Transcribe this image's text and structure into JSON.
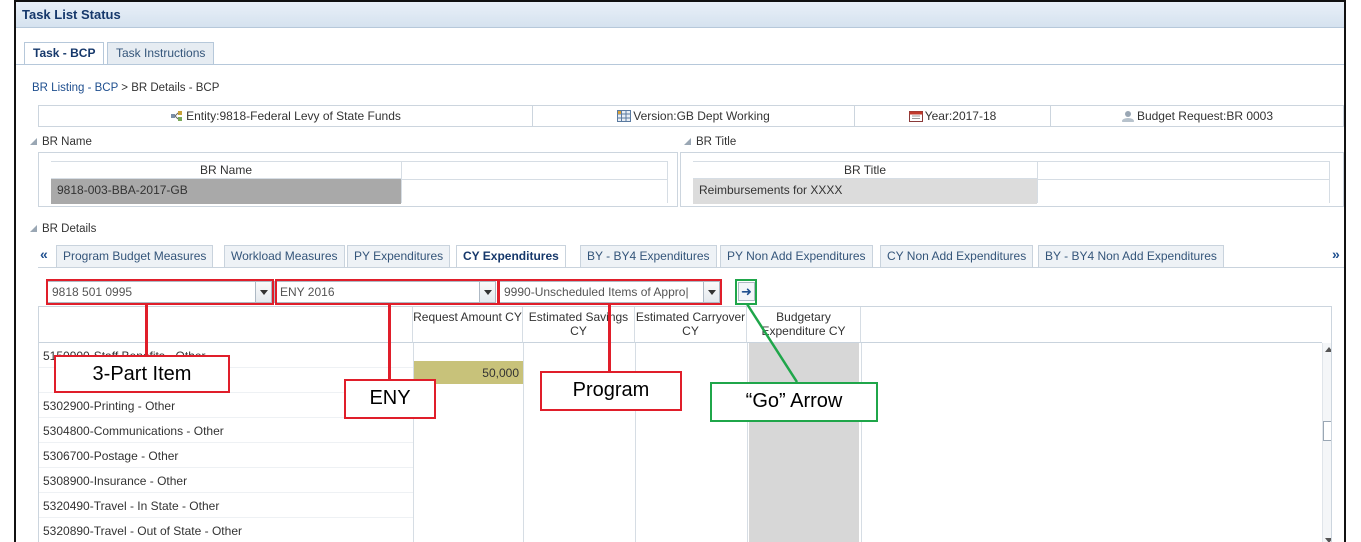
{
  "window": {
    "title": "Task List Status"
  },
  "tabs": [
    {
      "label": "Task - BCP",
      "active": true
    },
    {
      "label": "Task Instructions",
      "active": false
    }
  ],
  "breadcrumb": {
    "link": "BR Listing - BCP",
    "separator": " > ",
    "current": "BR Details - BCP"
  },
  "pov": {
    "entity": "Entity:9818-Federal Levy of State Funds",
    "version": "Version:GB Dept Working",
    "year": "Year:2017-18",
    "budget_request": "Budget Request:BR 0003"
  },
  "br_name": {
    "section_label": "BR Name",
    "column_header": "BR Name",
    "value": "9818-003-BBA-2017-GB"
  },
  "br_title": {
    "section_label": "BR Title",
    "column_header": "BR Title",
    "value": "Reimbursements for XXXX"
  },
  "br_details": {
    "section_label": "BR Details",
    "tabs": [
      "Program Budget Measures",
      "Workload Measures",
      "PY Expenditures",
      "CY Expenditures",
      "BY - BY4 Expenditures",
      "PY Non Add Expenditures",
      "CY Non Add Expenditures",
      "BY - BY4 Non Add Expenditures"
    ],
    "active_tab": "CY Expenditures",
    "prev_symbol": "«",
    "next_symbol": "»"
  },
  "selectors": {
    "three_part_item": "9818 501 0995",
    "eny": "ENY 2016",
    "program": "9990-Unscheduled Items of Appro|",
    "go_symbol": "➜"
  },
  "grid": {
    "columns": [
      "Request Amount CY",
      "Estimated Savings CY",
      "Estimated Carryover CY",
      "Budgetary Expenditure CY"
    ],
    "rows": [
      {
        "label": "5150900-Staff Benefits - Other",
        "request_amount": ""
      },
      {
        "label": "",
        "request_amount": "50,000"
      },
      {
        "label": "5302900-Printing - Other",
        "request_amount": ""
      },
      {
        "label": "5304800-Communications - Other",
        "request_amount": ""
      },
      {
        "label": "5306700-Postage - Other",
        "request_amount": ""
      },
      {
        "label": "5308900-Insurance - Other",
        "request_amount": ""
      },
      {
        "label": "5320490-Travel - In State - Other",
        "request_amount": ""
      },
      {
        "label": "5320890-Travel - Out of State - Other",
        "request_amount": ""
      }
    ]
  },
  "annotations": {
    "three_part_item": "3-Part Item",
    "eny": "ENY",
    "program": "Program",
    "go_arrow": "“Go” Arrow"
  },
  "colors": {
    "annotation_red": "#e01e2a",
    "annotation_green": "#1fa64a",
    "highlight_cell": "#c8c27a",
    "name_cell": "#a9a9a9",
    "title_cell": "#dcdcdc",
    "budgetary_col": "#d7d7d7"
  }
}
